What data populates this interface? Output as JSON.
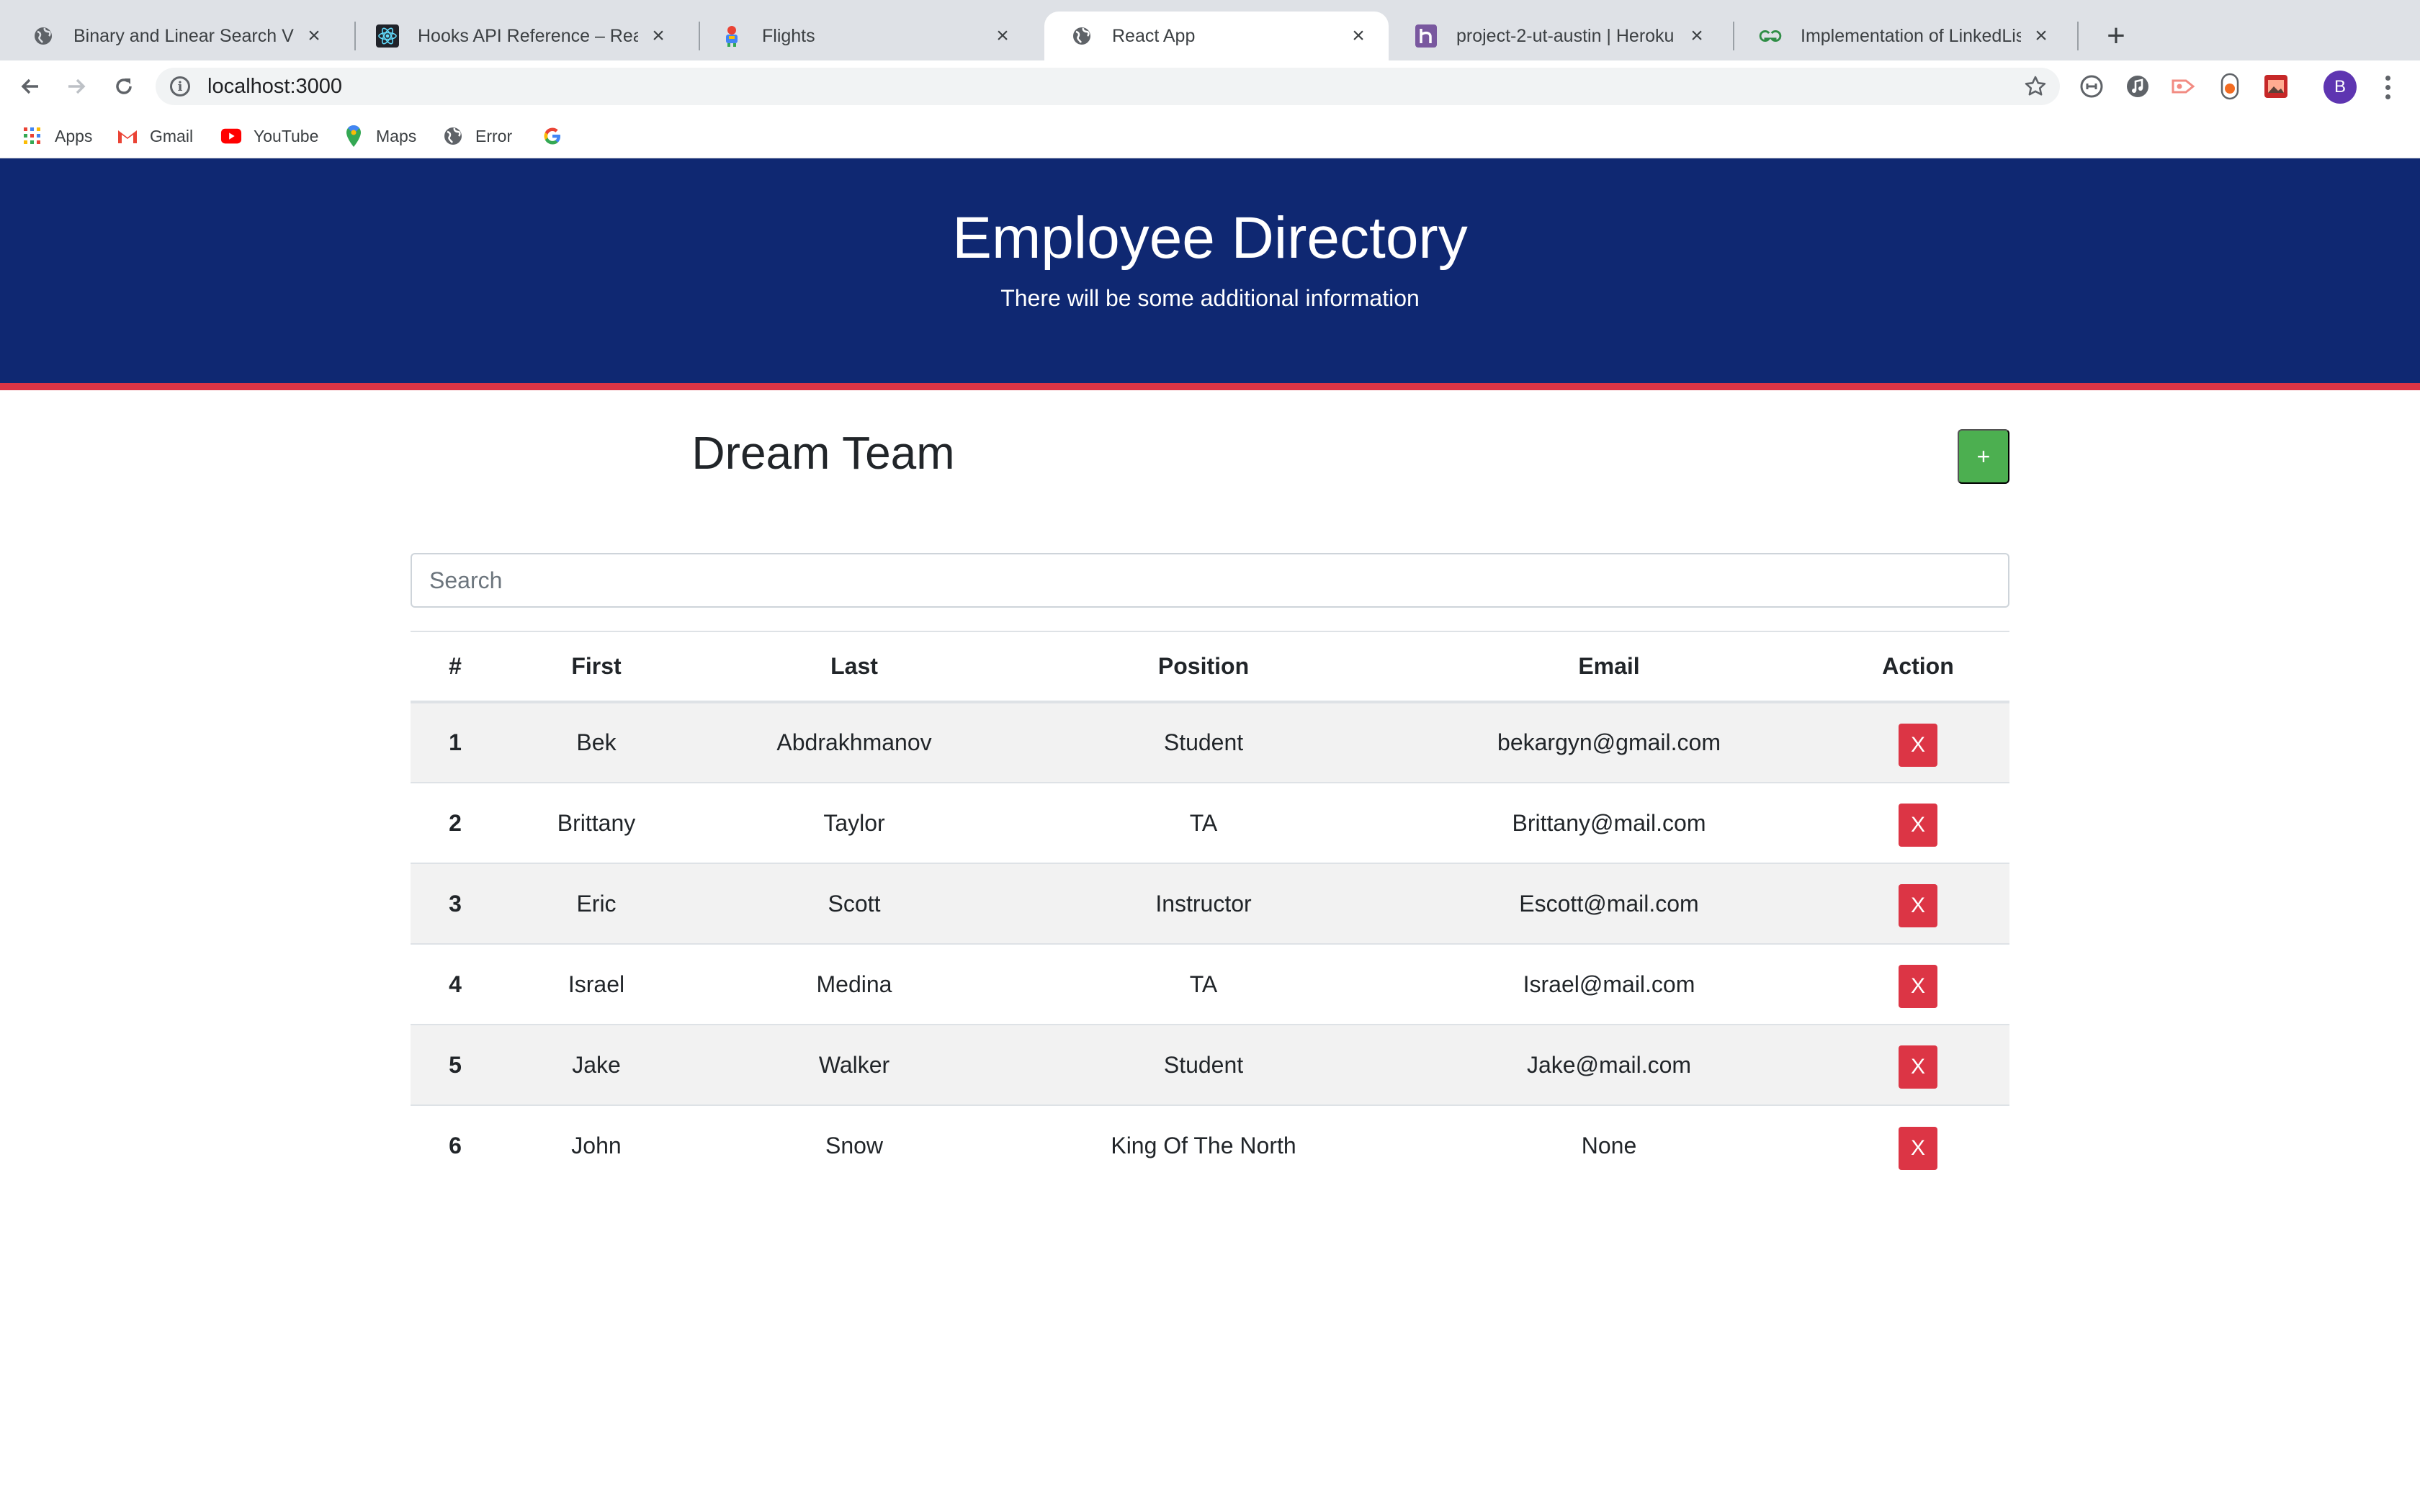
{
  "browser": {
    "tabs": [
      {
        "title": "Binary and Linear Search Visualiz",
        "icon": "globe-icon"
      },
      {
        "title": "Hooks API Reference – React",
        "icon": "react-icon"
      },
      {
        "title": "Flights",
        "icon": "flights-icon"
      },
      {
        "title": "React App",
        "icon": "globe-icon",
        "active": true
      },
      {
        "title": "project-2-ut-austin | Heroku",
        "icon": "heroku-icon"
      },
      {
        "title": "Implementation of LinkedList in J",
        "icon": "geeksforgeeks-icon"
      }
    ],
    "new_tab_label": "+",
    "url": "localhost:3000",
    "profile_initial": "B",
    "bookmarks": [
      {
        "label": "Apps",
        "icon": "apps-grid-icon"
      },
      {
        "label": "Gmail",
        "icon": "gmail-icon"
      },
      {
        "label": "YouTube",
        "icon": "youtube-icon"
      },
      {
        "label": "Maps",
        "icon": "maps-icon"
      },
      {
        "label": "Error",
        "icon": "globe-icon"
      },
      {
        "label": "",
        "icon": "google-icon"
      }
    ]
  },
  "header": {
    "title": "Employee Directory",
    "subtitle": "There will be some additional information"
  },
  "team": {
    "title": "Dream Team",
    "add_label": "+"
  },
  "search": {
    "placeholder": "Search",
    "value": ""
  },
  "table": {
    "headers": [
      "#",
      "First",
      "Last",
      "Position",
      "Email",
      "Action"
    ],
    "delete_label": "X",
    "rows": [
      {
        "num": "1",
        "first": "Bek",
        "last": "Abdrakhmanov",
        "position": "Student",
        "email": "bekargyn@gmail.com"
      },
      {
        "num": "2",
        "first": "Brittany",
        "last": "Taylor",
        "position": "TA",
        "email": "Brittany@mail.com"
      },
      {
        "num": "3",
        "first": "Eric",
        "last": "Scott",
        "position": "Instructor",
        "email": "Escott@mail.com"
      },
      {
        "num": "4",
        "first": "Israel",
        "last": "Medina",
        "position": "TA",
        "email": "Israel@mail.com"
      },
      {
        "num": "5",
        "first": "Jake",
        "last": "Walker",
        "position": "Student",
        "email": "Jake@mail.com"
      },
      {
        "num": "6",
        "first": "John",
        "last": "Snow",
        "position": "King Of The North",
        "email": "None"
      }
    ]
  },
  "colors": {
    "header_bg": "#0f2872",
    "header_accent": "#dc3545",
    "add_button": "#4caf50",
    "delete_button": "#dc3545",
    "striped_row": "#f2f2f2"
  }
}
